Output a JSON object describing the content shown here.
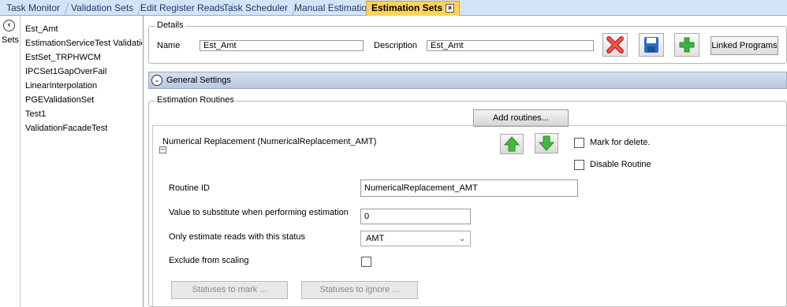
{
  "tabs": [
    {
      "label": "Task Monitor"
    },
    {
      "label": "Validation Sets"
    },
    {
      "label": "Edit Register Reads"
    },
    {
      "label": "Task Scheduler"
    },
    {
      "label": "Manual Estimation"
    },
    {
      "label": "Estimation Sets",
      "active": true,
      "close": "×"
    }
  ],
  "sidebar": {
    "collapse_icon": "chevron-left-icon",
    "sets_label": "Sets",
    "items": [
      {
        "label": "Est_Amt"
      },
      {
        "label": "EstimationServiceTest Validation :"
      },
      {
        "label": "EstSet_TRPHWCM"
      },
      {
        "label": "IPCSet1GapOverFail"
      },
      {
        "label": "LinearInterpolation"
      },
      {
        "label": "PGEValidationSet"
      },
      {
        "label": "Test1"
      },
      {
        "label": "ValidationFacadeTest"
      }
    ]
  },
  "details": {
    "title": "Details",
    "name_label": "Name",
    "name_value": "Est_Amt",
    "description_label": "Description",
    "description_value": "Est_Amt",
    "delete_icon": "delete-x-icon",
    "save_icon": "save-floppy-icon",
    "add_icon": "add-plus-icon",
    "linked_programs_label": "Linked Programs"
  },
  "general_settings": {
    "label": "General Settings",
    "icon": "chevron-down-icon"
  },
  "routines": {
    "title": "Estimation Routines",
    "add_label": "Add routines...",
    "routine": {
      "header": "Numerical Replacement (NumericalReplacement_AMT)",
      "expand_icon": "minus",
      "mark_delete_label": "Mark for delete.",
      "disable_label": "Disable Routine",
      "routine_id_label": "Routine ID",
      "routine_id_value": "NumericalReplacement_AMT",
      "substitute_label": "Value to substitute when performing estimation",
      "substitute_value": "0",
      "status_label": "Only estimate reads with this status",
      "status_value": "AMT",
      "exclude_label": "Exclude from scaling",
      "statuses_mark_label": "Statuses to mark ...",
      "statuses_ignore_label": "Statuses to ignore ..."
    }
  },
  "colors": {
    "tab_active": "#ffd25a",
    "tabbar": "#d4e4f7",
    "delete_red": "#d9342b",
    "save_blue": "#2e6dc2",
    "add_green": "#3cb043",
    "arrow_green": "#48b83e"
  }
}
